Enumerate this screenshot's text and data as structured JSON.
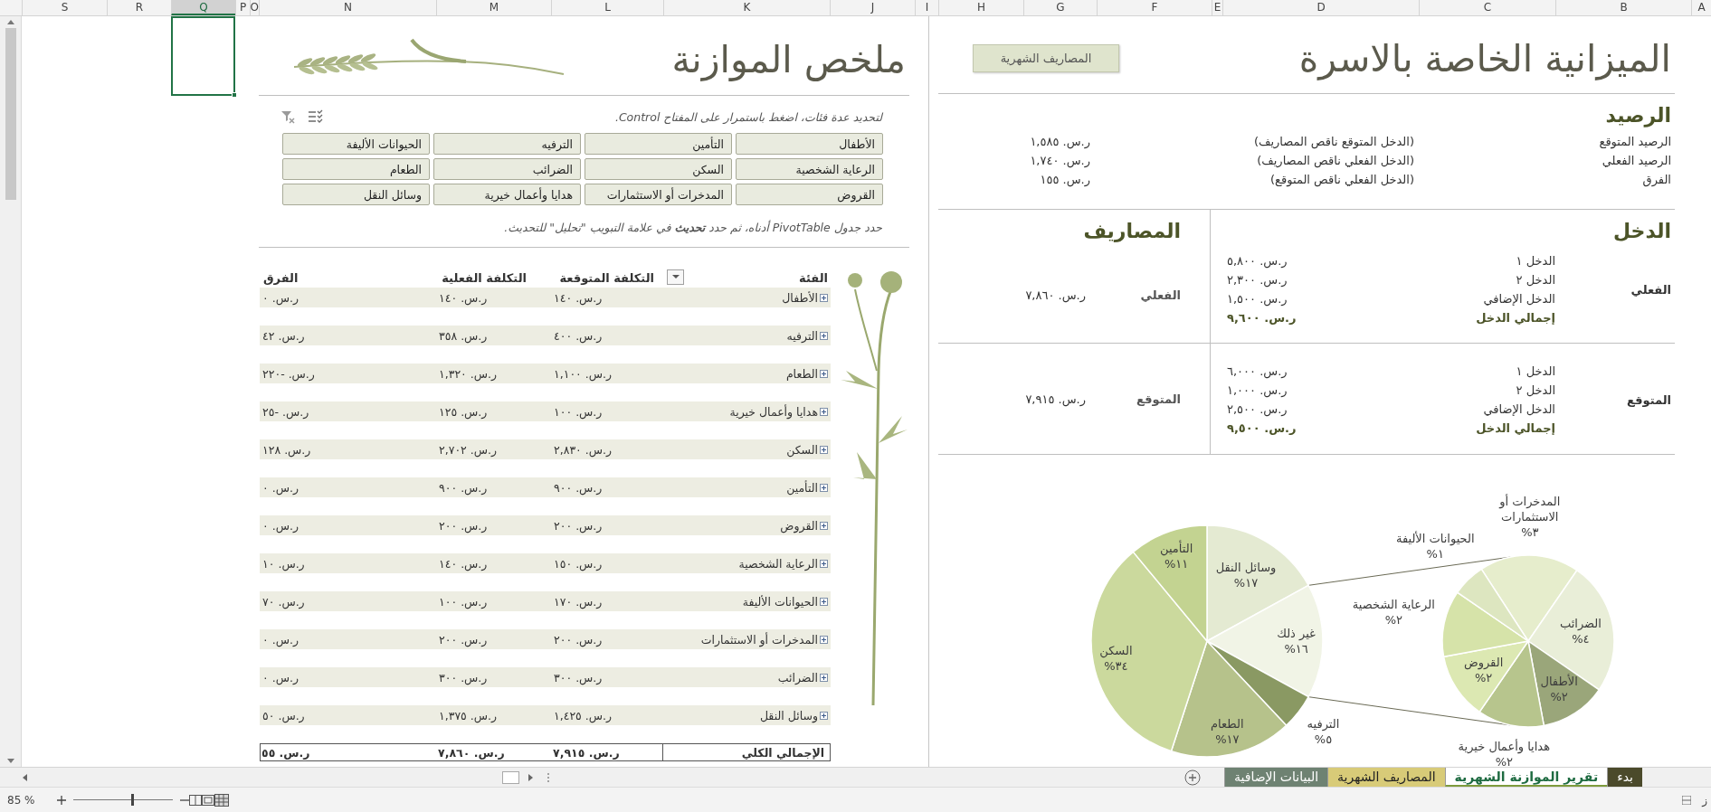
{
  "column_headers": [
    {
      "label": "A",
      "selected": false
    },
    {
      "label": "B",
      "selected": false
    },
    {
      "label": "C",
      "selected": false
    },
    {
      "label": "D",
      "selected": false
    },
    {
      "label": "E",
      "selected": false
    },
    {
      "label": "F",
      "selected": false
    },
    {
      "label": "G",
      "selected": false
    },
    {
      "label": "H",
      "selected": false
    },
    {
      "label": "I",
      "selected": false
    },
    {
      "label": "J",
      "selected": false
    },
    {
      "label": "K",
      "selected": false
    },
    {
      "label": "L",
      "selected": false
    },
    {
      "label": "M",
      "selected": false
    },
    {
      "label": "N",
      "selected": false
    },
    {
      "label": "O",
      "selected": false
    },
    {
      "label": "P",
      "selected": false
    },
    {
      "label": "Q",
      "selected": true
    },
    {
      "label": "R",
      "selected": false
    },
    {
      "label": "S",
      "selected": false
    }
  ],
  "summary": {
    "title": "ملخص الموازنة",
    "slicer": {
      "hint": "لتحديد عدة فئات، اضغط باستمرار على المفتاح Control.",
      "items": [
        {
          "label": "الأطفال",
          "selected": true
        },
        {
          "label": "التأمين",
          "selected": true
        },
        {
          "label": "الترفيه",
          "selected": true
        },
        {
          "label": "الحيوانات الأليفة",
          "selected": true
        },
        {
          "label": "الرعاية الشخصية",
          "selected": true
        },
        {
          "label": "السكن",
          "selected": true
        },
        {
          "label": "الضرائب",
          "selected": true
        },
        {
          "label": "الطعام",
          "selected": true
        },
        {
          "label": "القروض",
          "selected": true
        },
        {
          "label": "المدخرات أو الاستثمارات",
          "selected": true
        },
        {
          "label": "هدايا وأعمال خيرية",
          "selected": true
        },
        {
          "label": "وسائل النقل",
          "selected": true
        }
      ]
    },
    "note": "حدد جدول PivotTable أدناه، ثم حدد **تحديث** في علامة التبويب \"تحليل\" للتحديث.",
    "pivot": {
      "columns": [
        "الفئة",
        "التكلفة المتوقعة",
        "التكلفة الفعلية",
        "الفرق"
      ],
      "rows": [
        {
          "category": "الأطفال",
          "expected": "ر.س. ١٤٠",
          "actual": "ر.س. ١٤٠",
          "difference": "ر.س. ٠"
        },
        {
          "category": "الترفيه",
          "expected": "ر.س. ٤٠٠",
          "actual": "ر.س. ٣٥٨",
          "difference": "ر.س. ٤٢"
        },
        {
          "category": "الطعام",
          "expected": "ر.س. ١,١٠٠",
          "actual": "ر.س. ١,٣٢٠",
          "difference": "ر.س. -٢٢٠"
        },
        {
          "category": "هدايا وأعمال خيرية",
          "expected": "ر.س. ١٠٠",
          "actual": "ر.س. ١٢٥",
          "difference": "ر.س. -٢٥"
        },
        {
          "category": "السكن",
          "expected": "ر.س. ٢,٨٣٠",
          "actual": "ر.س. ٢,٧٠٢",
          "difference": "ر.س. ١٢٨"
        },
        {
          "category": "التأمين",
          "expected": "ر.س. ٩٠٠",
          "actual": "ر.س. ٩٠٠",
          "difference": "ر.س. ٠"
        },
        {
          "category": "القروض",
          "expected": "ر.س. ٢٠٠",
          "actual": "ر.س. ٢٠٠",
          "difference": "ر.س. ٠"
        },
        {
          "category": "الرعاية الشخصية",
          "expected": "ر.س. ١٥٠",
          "actual": "ر.س. ١٤٠",
          "difference": "ر.س. ١٠"
        },
        {
          "category": "الحيوانات الأليفة",
          "expected": "ر.س. ١٧٠",
          "actual": "ر.س. ١٠٠",
          "difference": "ر.س. ٧٠"
        },
        {
          "category": "المدخرات أو الاستثمارات",
          "expected": "ر.س. ٢٠٠",
          "actual": "ر.س. ٢٠٠",
          "difference": "ر.س. ٠"
        },
        {
          "category": "الضرائب",
          "expected": "ر.س. ٣٠٠",
          "actual": "ر.س. ٣٠٠",
          "difference": "ر.س. ٠"
        },
        {
          "category": "وسائل النقل",
          "expected": "ر.س. ١,٤٢٥",
          "actual": "ر.س. ١,٣٧٥",
          "difference": "ر.س. ٥٠"
        }
      ],
      "total": {
        "label": "الإجمالي الكلي",
        "expected": "ر.س. ٧,٩١٥",
        "actual": "ر.س. ٧,٨٦٠",
        "difference": "ر.س. ٥٥"
      }
    }
  },
  "budget": {
    "title": "الميزانية الخاصة بالاسرة",
    "button": "المصاريف الشهرية",
    "balance": {
      "heading": "الرصيد",
      "rows": [
        {
          "label": "الرصيد المتوقع",
          "formula": "(الدخل المتوقع ناقص المصاريف)",
          "value": "ر.س. ١,٥٨٥"
        },
        {
          "label": "الرصيد الفعلي",
          "formula": "(الدخل الفعلي ناقص المصاريف)",
          "value": "ر.س. ١,٧٤٠"
        },
        {
          "label": "الفرق",
          "formula": "(الدخل الفعلي ناقص المتوقع)",
          "value": "ر.س. ١٥٥"
        }
      ]
    },
    "income_heading": "الدخل",
    "expenses_heading": "المصاريف",
    "blocks": [
      {
        "label": "الفعلي",
        "income": [
          {
            "kind": "item",
            "label": "الدخل ١",
            "value": "ر.س. ٥,٨٠٠"
          },
          {
            "kind": "item",
            "label": "الدخل ٢",
            "value": "ر.س. ٢,٣٠٠"
          },
          {
            "kind": "item",
            "label": "الدخل الإضافي",
            "value": "ر.س. ١,٥٠٠"
          },
          {
            "kind": "total",
            "label": "إجمالي الدخل",
            "value": "ر.س. ٩,٦٠٠"
          }
        ],
        "expense_label": "الفعلي",
        "expense_value": "ر.س. ٧,٨٦٠"
      },
      {
        "label": "المتوقع",
        "income": [
          {
            "kind": "item",
            "label": "الدخل ١",
            "value": "ر.س. ٦,٠٠٠"
          },
          {
            "kind": "item",
            "label": "الدخل ٢",
            "value": "ر.س. ١,٠٠٠"
          },
          {
            "kind": "item",
            "label": "الدخل الإضافي",
            "value": "ر.س. ٢,٥٠٠"
          },
          {
            "kind": "total",
            "label": "إجمالي الدخل",
            "value": "ر.س. ٩,٥٠٠"
          }
        ],
        "expense_label": "المتوقع",
        "expense_value": "ر.س. ٧,٩١٥"
      }
    ],
    "chart": {
      "main": {
        "chart_data": {
          "type": "pie",
          "categories": [
            "وسائل النقل",
            "غير ذلك",
            "الترفيه",
            "الطعام",
            "السكن",
            "التأمين"
          ],
          "values": [
            17,
            16,
            5,
            17,
            34,
            11
          ],
          "data_labels": true,
          "value_labels": [
            "١٧%",
            "١٦%",
            "٥%",
            "١٧%",
            "٣٤%",
            "١١%"
          ]
        }
      },
      "secondary": {
        "chart_data": {
          "type": "pie",
          "categories": [
            "المدخرات أو الاستثمارات",
            "الضرائب",
            "الأطفال",
            "هدايا وأعمال خيرية",
            "القروض",
            "الرعاية الشخصية",
            "الحيوانات الأليفة"
          ],
          "values": [
            3,
            4,
            2,
            2,
            2,
            2,
            1
          ],
          "data_labels": true,
          "value_labels": [
            "٣%",
            "٤%",
            "٢%",
            "٢%",
            "٢%",
            "٢%",
            "١%"
          ]
        }
      }
    }
  },
  "sheet_tabs": [
    {
      "label": "بدء",
      "selected": false,
      "color": "#4b4a2b"
    },
    {
      "label": "تقرير الموازنة الشهرية",
      "selected": true,
      "color": "#7e9b3c"
    },
    {
      "label": "المصاريف الشهرية",
      "selected": false,
      "color": "#d8cb78"
    },
    {
      "label": "البيانات الإضافية",
      "selected": false,
      "color": "#6e8272"
    }
  ],
  "status_bar": {
    "text": "ز",
    "zoom": "85 %",
    "zoom_slider": {
      "level": 0.58
    }
  }
}
